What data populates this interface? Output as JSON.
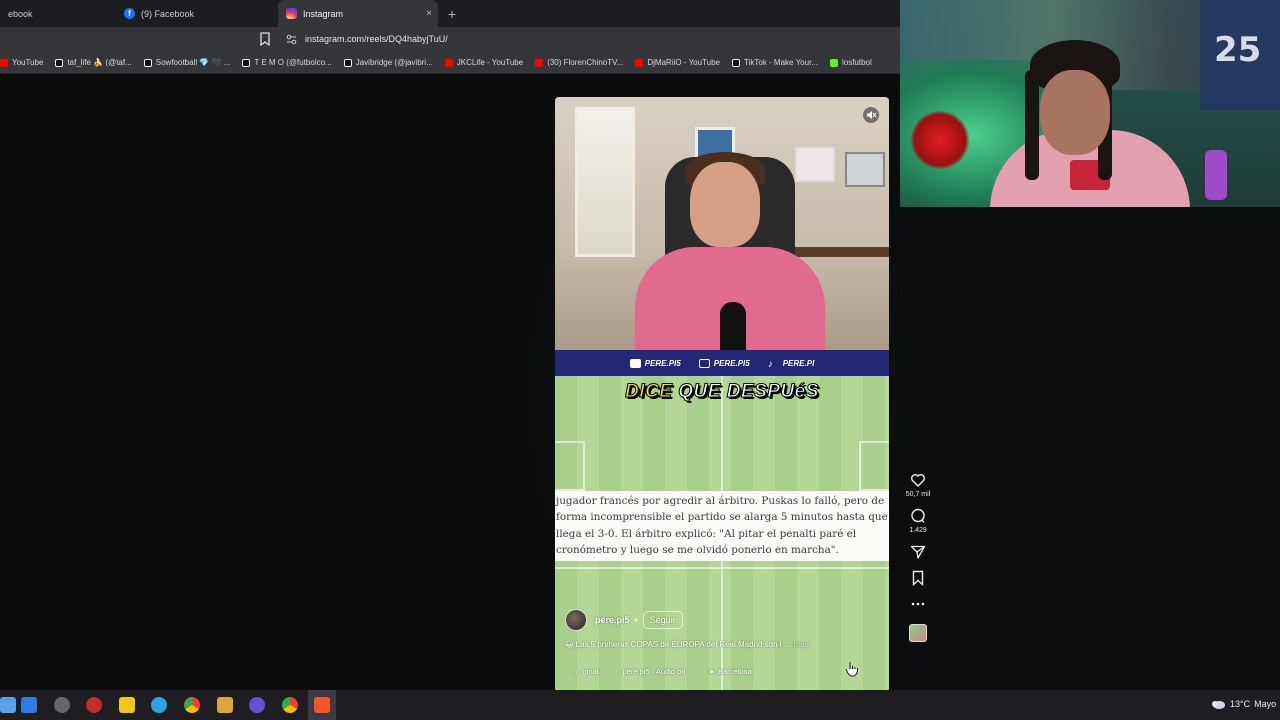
{
  "browser": {
    "tabs": [
      {
        "label": "ebook",
        "icon": "facebook-icon"
      },
      {
        "label": "(9) Facebook",
        "icon": "facebook-icon"
      },
      {
        "label": "Instagram",
        "icon": "instagram-icon",
        "active": true
      }
    ],
    "new_tab": "+",
    "close": "×",
    "url": "instagram.com/reels/DQ4habyjTuU/",
    "bookmarks": [
      {
        "label": "YouTube",
        "icon": "youtube-icon"
      },
      {
        "label": "taf_life 🍌 (@taf...",
        "icon": "tiktok-icon"
      },
      {
        "label": "Sowfootball 💎 🖤 ...",
        "icon": "tiktok-icon"
      },
      {
        "label": "T E M O (@futbolco...",
        "icon": "tiktok-icon"
      },
      {
        "label": "Javibridge (@javibri...",
        "icon": "tiktok-icon"
      },
      {
        "label": "JKCLife - YouTube",
        "icon": "youtube-icon"
      },
      {
        "label": "(30) FlorenChinoTV...",
        "icon": "youtube-icon"
      },
      {
        "label": "DjMaRiiO - YouTube",
        "icon": "youtube-icon"
      },
      {
        "label": "TikTok - Make Your...",
        "icon": "tiktok-icon"
      },
      {
        "label": "losfutbol",
        "icon": "kick-icon"
      }
    ]
  },
  "reel": {
    "social_handles": [
      {
        "label": "PERE.PI5",
        "icon": "youtube-icon"
      },
      {
        "label": "PERE.PI5",
        "icon": "instagram-icon"
      },
      {
        "label": "PERE.PI",
        "icon": "tiktok-icon"
      }
    ],
    "title_word1": "DICE",
    "title_rest": "QUE DESPUéS",
    "caption": "jugador francés por agredir al árbitro. Puskas lo falló, pero de forma incomprensible el partido se alarga 5 minutos hasta que llega el 3-0. El árbitro explicó: \"Al pitar el penalti paré el cronómetro y luego se me olvidó ponerlo en marcha\".",
    "username": "pere.pi5",
    "dot": "•",
    "follow_label": "Seguir",
    "description": "Las 5 primeras COPAS de EUROPA del Real Madrid son l ...",
    "more_label": "más",
    "audio_label": "ginal",
    "audio_source": "pere.pi5 · Audio ori",
    "location": "Barcelona"
  },
  "actions": {
    "likes": "50,7 mil",
    "comments": "1.429"
  },
  "webcam": {
    "jersey_number": "25"
  },
  "taskbar": {
    "temperature": "13°C",
    "weather_text": "Mayo"
  },
  "colors": {
    "strip": "#232876",
    "title_yellow": "#f1e21e",
    "pitch": "#a8d08a"
  }
}
